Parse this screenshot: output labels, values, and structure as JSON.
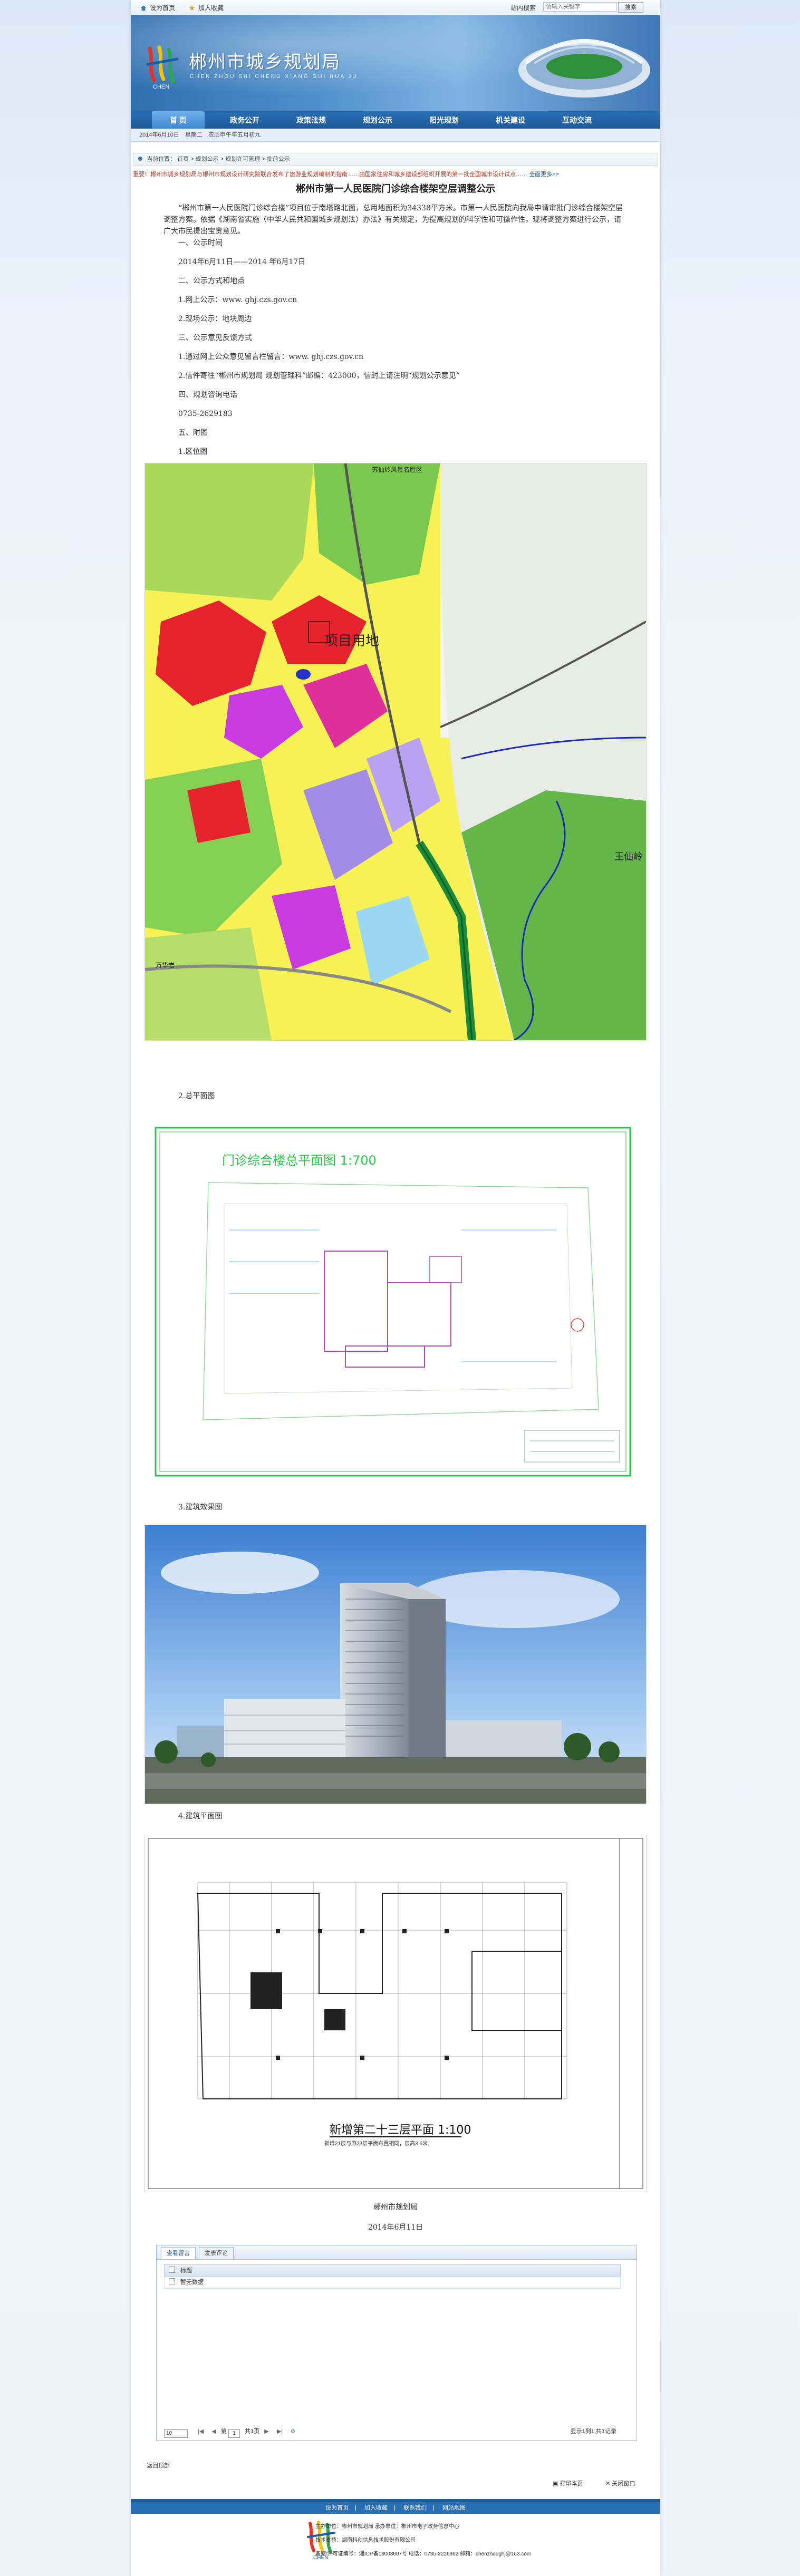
{
  "topbar": {
    "home_link": "设为首页",
    "fav_link": "加入收藏",
    "search_label": "站内搜索",
    "search_placeholder": "请输入关键字",
    "search_button": "搜索"
  },
  "banner": {
    "title": "郴州市城乡规划局",
    "subtitle": "CHEN ZHOU SHI CHENG XIANG GUI HUA JU",
    "logo_text": "CHEN"
  },
  "nav": {
    "items": [
      "首 页",
      "政务公开",
      "政策法规",
      "规划公示",
      "阳光规划",
      "机关建设",
      "互动交流"
    ],
    "active_index": 0
  },
  "datebar": {
    "date": "2014年6月10日",
    "weekday": "星期二",
    "lunar": "农历甲午年五月初九"
  },
  "breadcrumb": {
    "prefix": "当前位置：",
    "items": [
      "首页",
      "规划公示",
      "规划许可管理",
      "批前公示"
    ]
  },
  "marquee": {
    "text": "重要！郴州市城乡规划局与郴州市规划设计研究院联合发布了旅游业规划编制的指南……由国家住房和城乡建设部组织开展的第一批全国城市设计试点……",
    "more": "全面更多>>"
  },
  "article": {
    "title": "郴州市第一人民医院门诊综合楼架空层调整公示",
    "intro": "“郴州市第一人民医院门诊综合楼”项目位于南塔路北面，总用地面积为34338平方米。市第一人民医院向我局申请审批门诊综合楼架空层调整方案。依据《湖南省实施〈中华人民共和国城乡规划法〉办法》有关规定，为提高规划的科学性和可操作性，现将调整方案进行公示，请广大市民提出宝贵意见。",
    "s1": "一、公示时间",
    "s1_text": "2014年6月11日——2014 年6月17日",
    "s2": "二、公示方式和地点",
    "s2_1": "1.网上公示：www. ghj.czs.gov.cn",
    "s2_2": "2.现场公示：地块周边",
    "s3": "三、公示意见反馈方式",
    "s3_1": "1.通过网上公众意见留言栏留言：www. ghj.czs.gov.cn",
    "s3_2": "2.信件寄往“郴州市规划局 规划管理科”邮编：423000，信封上请注明“规划公示意见”",
    "s4": "四、规划咨询电话",
    "s4_text": "0735-2629183",
    "s5": "五、附图",
    "fig1": "1.区位图",
    "fig2": "2.总平面图",
    "fig3": "3.建筑效果图",
    "fig4": "4.建筑平面图",
    "signature": "郴州市规划局",
    "sign_date": "2014年6月11日"
  },
  "figures": {
    "map_label_park": "苏仙岭风景名胜区",
    "map_label_site": "项目用地",
    "map_label_right": "王仙岭",
    "map_label_lake": "万华岩",
    "site_plan_title": "门诊综合楼总平面图  1:700",
    "floor_plan_title": "新增第二十三层平面 1:100",
    "floor_plan_note": "新增21层与原23层平面布置相同，层高3.6米"
  },
  "comments": {
    "tab1": "查看留言",
    "tab2": "发表评论",
    "header": "标题",
    "row1": "暂无数据",
    "page_size": "10",
    "page_label": "第",
    "page_value": "1",
    "page_total": "共1页",
    "summary": "显示1到1,共1记录"
  },
  "links": {
    "back": "返回顶部",
    "print": "打印本页",
    "close": "关闭窗口"
  },
  "footer": {
    "nav": [
      "设为首页",
      "加入收藏",
      "联系我们",
      "网站地图"
    ],
    "line1": "主办单位：郴州市规划局  承办单位：郴州市电子政务信息中心",
    "line2": "技术支持：湖南科创信息技术股份有限公司",
    "line3": "备案/许可证编号：湘ICP备13003607号  电话：0735-2226362  邮箱：chenzhoughj@163.com"
  },
  "colors": {
    "nav_blue": "#1d5a98",
    "link_red": "#c0392b"
  }
}
